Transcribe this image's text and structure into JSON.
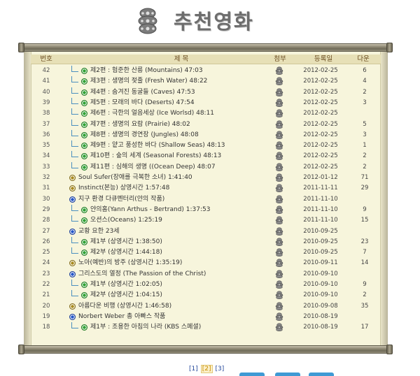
{
  "header": {
    "title": "추천영화",
    "logo_icon": "film-reels-icon"
  },
  "columns": {
    "no": "번호",
    "title": "제 목",
    "attach": "첨부",
    "date": "등록일",
    "down": "다운"
  },
  "rows": [
    {
      "no": "42",
      "title": "제2편 : 험준한 산릉 (Mountains) 47:03",
      "indent": 1,
      "dot": "green",
      "date": "2012-02-25",
      "down": "6"
    },
    {
      "no": "41",
      "title": "제3편 : 생명의 젖줄 (Fresh Water) 48:22",
      "indent": 1,
      "dot": "green",
      "date": "2012-02-25",
      "down": "4"
    },
    {
      "no": "40",
      "title": "제4편 : 숨겨진 동굴들 (Caves) 47:53",
      "indent": 1,
      "dot": "green",
      "date": "2012-02-25",
      "down": "2"
    },
    {
      "no": "39",
      "title": "제5편 : 모래의 바다 (Deserts) 47:54",
      "indent": 1,
      "dot": "green",
      "date": "2012-02-25",
      "down": "3"
    },
    {
      "no": "38",
      "title": "제6편 : 극한의 얼음세상 (Ice Worlsd) 48:11",
      "indent": 1,
      "dot": "green",
      "date": "2012-02-25",
      "down": ""
    },
    {
      "no": "37",
      "title": "제7편 : 생명의 요람 (Prairie) 48:02",
      "indent": 1,
      "dot": "green",
      "date": "2012-02-25",
      "down": "5"
    },
    {
      "no": "36",
      "title": "제8편 : 생명의 경연장 (Jungles) 48:08",
      "indent": 1,
      "dot": "green",
      "date": "2012-02-25",
      "down": "3"
    },
    {
      "no": "35",
      "title": "제9편 : 얕고 풍성한 바다 (Shallow Seas) 48:13",
      "indent": 1,
      "dot": "green",
      "date": "2012-02-25",
      "down": "1"
    },
    {
      "no": "34",
      "title": "제10편 : 숲의 세계 (Seasonal Forests) 48:13",
      "indent": 1,
      "dot": "green",
      "date": "2012-02-25",
      "down": "2"
    },
    {
      "no": "33",
      "title": "제11편 : 심해의 생명 ((Ocean Deep) 48:07",
      "indent": 1,
      "dot": "green",
      "date": "2012-02-25",
      "down": "2"
    },
    {
      "no": "32",
      "title": "Soul Sufer(장애를 극복한 소녀) 1:41:40",
      "indent": 0,
      "dot": "gold",
      "date": "2012-01-12",
      "down": "71"
    },
    {
      "no": "31",
      "title": "Instinct(본능) 상영시간 1:57:48",
      "indent": 0,
      "dot": "gold",
      "date": "2011-11-11",
      "down": "29"
    },
    {
      "no": "30",
      "title": "지구 환경 다큐멘터리(얀의 작품)",
      "indent": 0,
      "dot": "blue",
      "date": "2011-11-10",
      "down": ""
    },
    {
      "no": "29",
      "title": "얀의홈(Yann Arthus - Bertrand) 1:37:53",
      "indent": 1,
      "dot": "green",
      "date": "2011-11-10",
      "down": "9"
    },
    {
      "no": "28",
      "title": "오션스(Oceans) 1:25:19",
      "indent": 1,
      "dot": "green",
      "date": "2011-11-10",
      "down": "15"
    },
    {
      "no": "27",
      "title": "교황 요한 23세",
      "indent": 0,
      "dot": "blue",
      "date": "2010-09-25",
      "down": ""
    },
    {
      "no": "26",
      "title": "제1부 (상영시간 1:38:50)",
      "indent": 1,
      "dot": "green",
      "date": "2010-09-25",
      "down": "23"
    },
    {
      "no": "25",
      "title": "제2부 (상영시간 1:44:18)",
      "indent": 1,
      "dot": "green",
      "date": "2010-09-25",
      "down": "7"
    },
    {
      "no": "24",
      "title": "노아(예반)의 방주 (상영시간 1:35:19)",
      "indent": 0,
      "dot": "gold",
      "date": "2010-09-11",
      "down": "14"
    },
    {
      "no": "23",
      "title": "그리스도의 열정 (The Passion of the Christ)",
      "indent": 0,
      "dot": "blue",
      "date": "2010-09-10",
      "down": ""
    },
    {
      "no": "22",
      "title": "제1부 (상영시간 1:02:05)",
      "indent": 1,
      "dot": "green",
      "date": "2010-09-10",
      "down": "9"
    },
    {
      "no": "21",
      "title": "제2부 (상영시간 1:04:15)",
      "indent": 1,
      "dot": "green",
      "date": "2010-09-10",
      "down": "2"
    },
    {
      "no": "20",
      "title": "아름다운 비행 (상영시간 1:46:58)",
      "indent": 0,
      "dot": "gold",
      "date": "2010-09-08",
      "down": "35"
    },
    {
      "no": "19",
      "title": "Norbert Weber 총 아빠스 작품",
      "indent": 0,
      "dot": "blue",
      "date": "2010-08-19",
      "down": ""
    },
    {
      "no": "18",
      "title": "제1부 : 조용한 아침의 나라 (KBS 스페셜)",
      "indent": 1,
      "dot": "green",
      "date": "2010-08-19",
      "down": "17"
    }
  ],
  "pagination": {
    "pages": [
      "[1]",
      "[2]",
      "[3]"
    ],
    "current": "[2]"
  },
  "colors": {
    "paper": "#f7f5dc",
    "header_text": "#6a4b1f",
    "link": "#23479b"
  }
}
